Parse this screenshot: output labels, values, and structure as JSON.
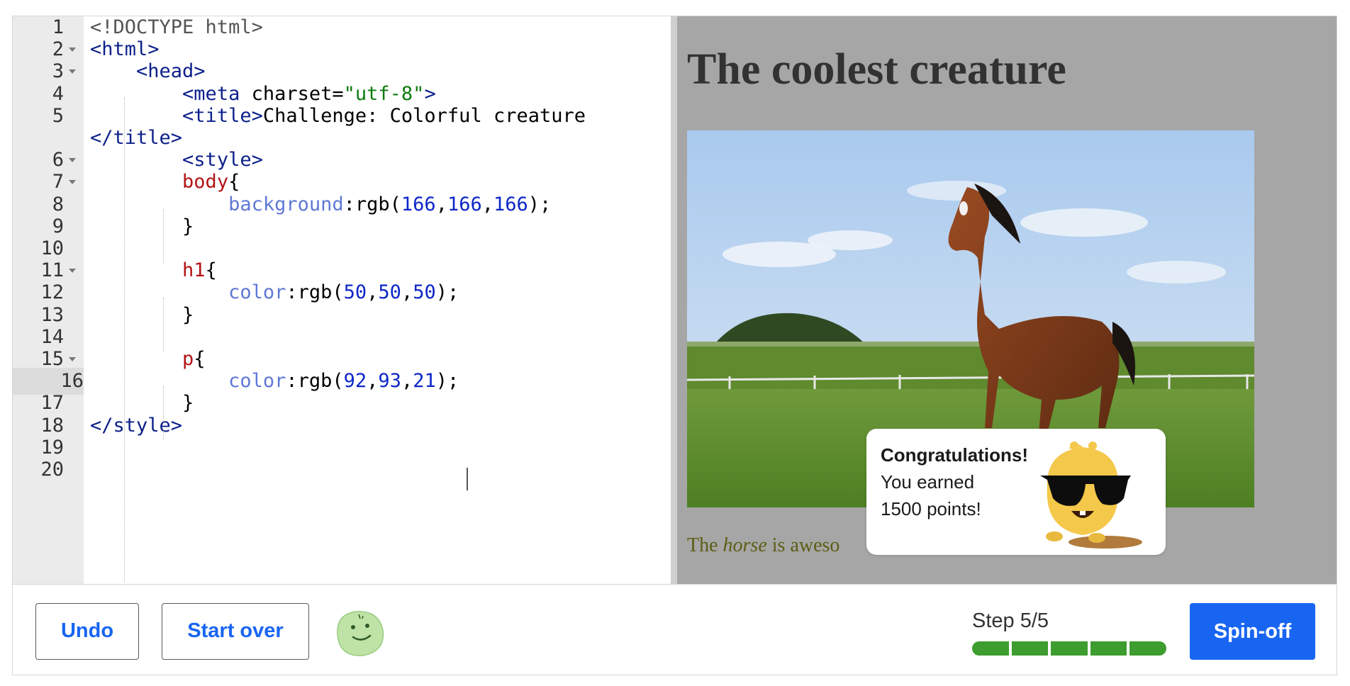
{
  "editor": {
    "lines": [
      {
        "num": "1",
        "fold": false,
        "tokens": [
          [
            "doc",
            "<!DOCTYPE html>"
          ]
        ]
      },
      {
        "num": "2",
        "fold": true,
        "tokens": [
          [
            "tag",
            "<html>"
          ]
        ]
      },
      {
        "num": "3",
        "fold": true,
        "tokens": [
          [
            "txt",
            "    "
          ],
          [
            "tag",
            "<head>"
          ]
        ]
      },
      {
        "num": "4",
        "fold": false,
        "tokens": [
          [
            "txt",
            "        "
          ],
          [
            "tag",
            "<meta"
          ],
          [
            "attr",
            " charset="
          ],
          [
            "str",
            "\"utf-8\""
          ],
          [
            "tag",
            ">"
          ]
        ]
      },
      {
        "num": "5",
        "fold": false,
        "tokens": [
          [
            "txt",
            "        "
          ],
          [
            "tag",
            "<title>"
          ],
          [
            "txt",
            "Challenge: Colorful creature"
          ]
        ]
      },
      {
        "num": "",
        "fold": false,
        "tokens": [
          [
            "tag",
            "</title>"
          ]
        ]
      },
      {
        "num": "6",
        "fold": true,
        "tokens": [
          [
            "txt",
            "        "
          ],
          [
            "tag",
            "<style>"
          ]
        ]
      },
      {
        "num": "7",
        "fold": true,
        "tokens": [
          [
            "txt",
            "        "
          ],
          [
            "sel",
            "body"
          ],
          [
            "txt",
            "{"
          ]
        ]
      },
      {
        "num": "8",
        "fold": false,
        "tokens": [
          [
            "txt",
            "            "
          ],
          [
            "prop",
            "background"
          ],
          [
            "txt",
            ":rgb("
          ],
          [
            "num",
            "166"
          ],
          [
            "txt",
            ","
          ],
          [
            "num",
            "166"
          ],
          [
            "txt",
            ","
          ],
          [
            "num",
            "166"
          ],
          [
            "txt",
            ");"
          ]
        ]
      },
      {
        "num": "9",
        "fold": false,
        "tokens": [
          [
            "txt",
            "        }"
          ]
        ]
      },
      {
        "num": "10",
        "fold": false,
        "tokens": []
      },
      {
        "num": "11",
        "fold": true,
        "tokens": [
          [
            "txt",
            "        "
          ],
          [
            "sel",
            "h1"
          ],
          [
            "txt",
            "{"
          ]
        ]
      },
      {
        "num": "12",
        "fold": false,
        "tokens": [
          [
            "txt",
            "            "
          ],
          [
            "prop",
            "color"
          ],
          [
            "txt",
            ":rgb("
          ],
          [
            "num",
            "50"
          ],
          [
            "txt",
            ","
          ],
          [
            "num",
            "50"
          ],
          [
            "txt",
            ","
          ],
          [
            "num",
            "50"
          ],
          [
            "txt",
            ");"
          ]
        ]
      },
      {
        "num": "13",
        "fold": false,
        "tokens": [
          [
            "txt",
            "        }"
          ]
        ]
      },
      {
        "num": "14",
        "fold": false,
        "tokens": []
      },
      {
        "num": "15",
        "fold": true,
        "tokens": [
          [
            "txt",
            "        "
          ],
          [
            "sel",
            "p"
          ],
          [
            "txt",
            "{"
          ]
        ]
      },
      {
        "num": "16",
        "fold": false,
        "active": true,
        "tokens": [
          [
            "txt",
            "            "
          ],
          [
            "prop",
            "color"
          ],
          [
            "txt",
            ":rgb("
          ],
          [
            "num",
            "92"
          ],
          [
            "txt",
            ","
          ],
          [
            "num",
            "93"
          ],
          [
            "txt",
            ","
          ],
          [
            "num",
            "21"
          ],
          [
            "txt",
            ");"
          ]
        ]
      },
      {
        "num": "17",
        "fold": false,
        "tokens": [
          [
            "txt",
            "        }"
          ]
        ]
      },
      {
        "num": "18",
        "fold": false,
        "tokens": [
          [
            "tag",
            "</style>"
          ]
        ]
      },
      {
        "num": "19",
        "fold": false,
        "tokens": []
      },
      {
        "num": "20",
        "fold": false,
        "tokens": []
      }
    ]
  },
  "preview": {
    "heading": "The coolest creature",
    "image_alt": "horse running in a grassy field",
    "paragraph_pre": "The ",
    "paragraph_em": "horse",
    "paragraph_post": " is aweso"
  },
  "popup": {
    "title": "Congratulations!",
    "line1": "You earned",
    "line2": "1500 points!"
  },
  "toolbar": {
    "undo_label": "Undo",
    "startover_label": "Start over",
    "step_label": "Step 5/5",
    "step_current": 5,
    "step_total": 5,
    "spinoff_label": "Spin-off"
  },
  "colors": {
    "accent_blue": "#1865f2",
    "progress_green": "#3d9d2e",
    "preview_bg": "#a6a6a6",
    "heading_color": "#323232",
    "para_color": "#5c5d15"
  }
}
